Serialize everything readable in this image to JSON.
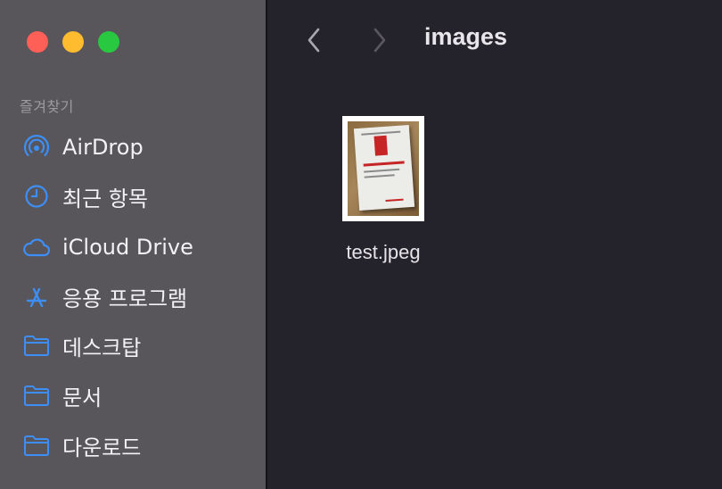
{
  "window": {
    "title": "images"
  },
  "sidebar": {
    "section_label": "즐겨찾기",
    "items": [
      {
        "label": "AirDrop",
        "icon": "airdrop-icon"
      },
      {
        "label": "최근 항목",
        "icon": "clock-icon"
      },
      {
        "label": "iCloud Drive",
        "icon": "cloud-icon"
      },
      {
        "label": "응용 프로그램",
        "icon": "applications-icon"
      },
      {
        "label": "데스크탑",
        "icon": "folder-icon"
      },
      {
        "label": "문서",
        "icon": "folder-icon"
      },
      {
        "label": "다운로드",
        "icon": "folder-icon"
      }
    ]
  },
  "files": [
    {
      "name": "test.jpeg",
      "icon": "jpeg-thumbnail"
    }
  ],
  "colors": {
    "sidebar_bg": "#58565a",
    "main_bg": "#24222a",
    "accent_icon": "#3d8ef7",
    "close": "#fe5f57",
    "minimize": "#febc2e",
    "maximize": "#28c840"
  }
}
